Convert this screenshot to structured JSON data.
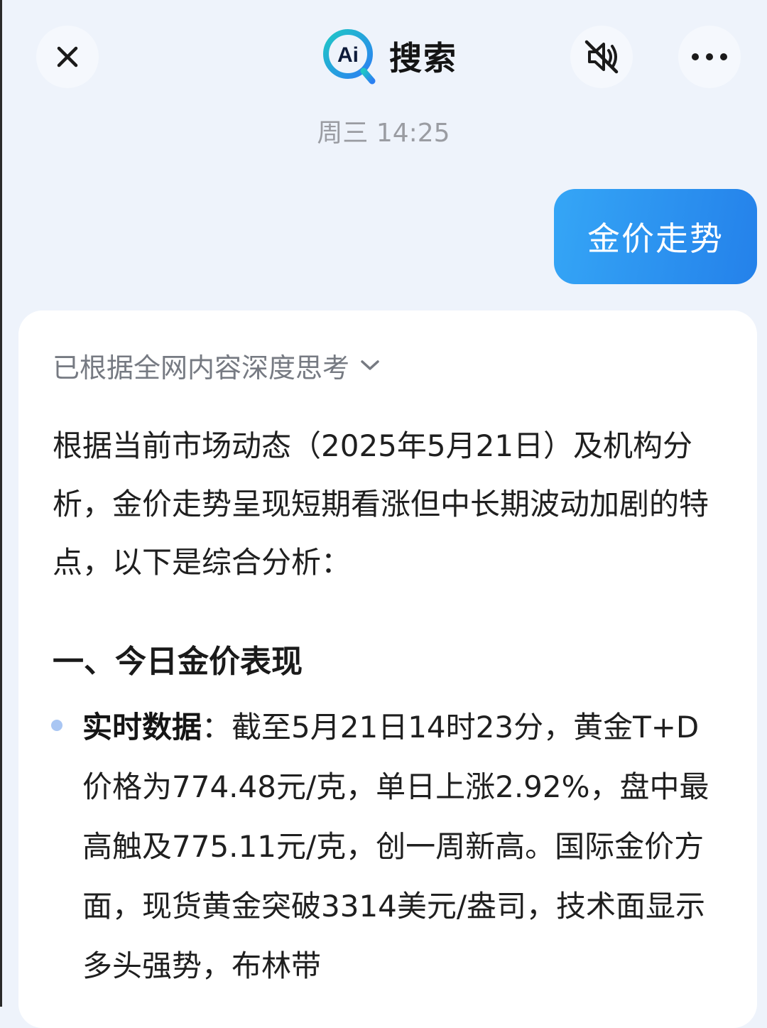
{
  "header": {
    "title": "搜索",
    "logo_text": "Ai",
    "close_icon": "close-icon",
    "mute_icon": "speaker-mute-icon",
    "more_icon": "more-horizontal-icon"
  },
  "timestamp": "周三 14:25",
  "user_message": "金价走势",
  "answer": {
    "thinking_label": "已根据全网内容深度思考",
    "intro": "根据当前市场动态（2025年5月21日）及机构分析，金价走势呈现短期看涨但中长期波动加剧的特点，以下是综合分析：",
    "section_title": "一、今日金价表现",
    "bullets": [
      {
        "label": "实时数据",
        "separator": "：",
        "text": "截至5月21日14时23分，黄金T+D价格为774.48元/克，单日上涨2.92%，盘中最高触及775.11元/克，创一周新高。国际金价方面，现货黄金突破3314美元/盎司，技术面显示多头强势，布林带"
      }
    ]
  },
  "colors": {
    "background": "#eef3fb",
    "bubble_start": "#35a6f6",
    "bubble_end": "#2481ea",
    "logo_teal": "#1fc7c6",
    "logo_blue": "#2b7ff2",
    "bullet": "#a9c6f3"
  }
}
